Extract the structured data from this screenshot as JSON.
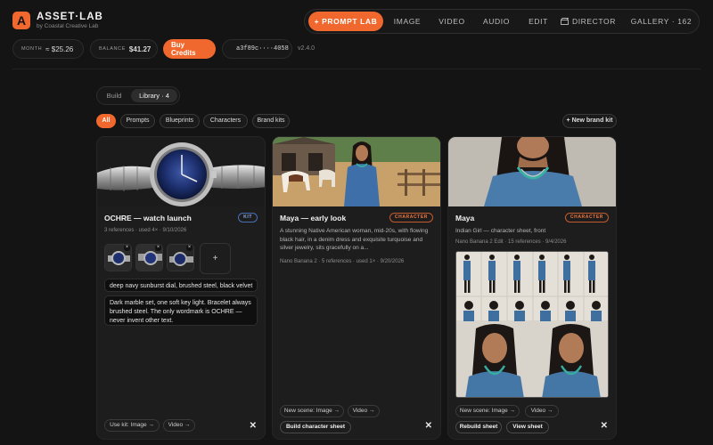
{
  "app": {
    "logo_letter": "A",
    "title": "ASSET·LAB",
    "subtitle": "by Coastal Creative Lab"
  },
  "nav": {
    "items": [
      {
        "label": "+ PROMPT LAB",
        "active": true
      },
      {
        "label": "IMAGE"
      },
      {
        "label": "VIDEO"
      },
      {
        "label": "AUDIO"
      },
      {
        "label": "EDIT"
      },
      {
        "label": "DIRECTOR",
        "icon": "clapper-icon"
      },
      {
        "label": "GALLERY · 162"
      }
    ]
  },
  "status": {
    "month_label": "MONTH",
    "month_value": "≈ $25.26",
    "balance_label": "BALANCE",
    "balance_value": "$41.27",
    "buy_label": "Buy Credits",
    "session_id": "a3f89c····4058",
    "version": "v2.4.0"
  },
  "view_toggle": {
    "build": "Build",
    "library": "Library · 4"
  },
  "filters": {
    "chips": [
      "All",
      "Prompts",
      "Blueprints",
      "Characters",
      "Brand kits"
    ],
    "new_brand_kit": "+ New brand kit"
  },
  "cards": [
    {
      "title": "OCHRE — watch launch",
      "badge": "KIT",
      "meta": "3 references · used 4× · 9/10/2026",
      "style_input": "deep navy sunburst dial, brushed steel, black velvet",
      "notes": "Dark marble set, one soft key light. Bracelet always brushed steel. The only wordmark is OCHRE — never invent other text.",
      "add": "+",
      "thumb_close": "×",
      "buttons": [
        "Use kit: Image →",
        "Video →"
      ],
      "close": "✕"
    },
    {
      "title": "Maya — early look",
      "badge": "CHARACTER",
      "description": "A stunning Native American woman, mid-20s, with flowing black hair, in a denim dress and exquisite turquoise and silver jewelry, sits gracefully on a...",
      "meta": "Nano Banana 2 · 5 references · used 1× · 9/20/2026",
      "buttons": [
        "New scene: Image →",
        "Video →",
        "Build character sheet"
      ],
      "close": "✕"
    },
    {
      "title": "Maya",
      "badge": "CHARACTER",
      "description": "Indian Girl — character sheet, front",
      "meta": "Nano Banana 2 Edit · 15 references · 9/4/2026",
      "buttons": [
        "New scene: Image →",
        "Video →",
        "Rebuild sheet",
        "View sheet"
      ],
      "close": "✕"
    }
  ],
  "colors": {
    "accent": "#f0682d",
    "background": "#141414",
    "card": "#1d1d1d",
    "kit_badge": "#8fb0f0",
    "character_badge": "#f0783e"
  }
}
